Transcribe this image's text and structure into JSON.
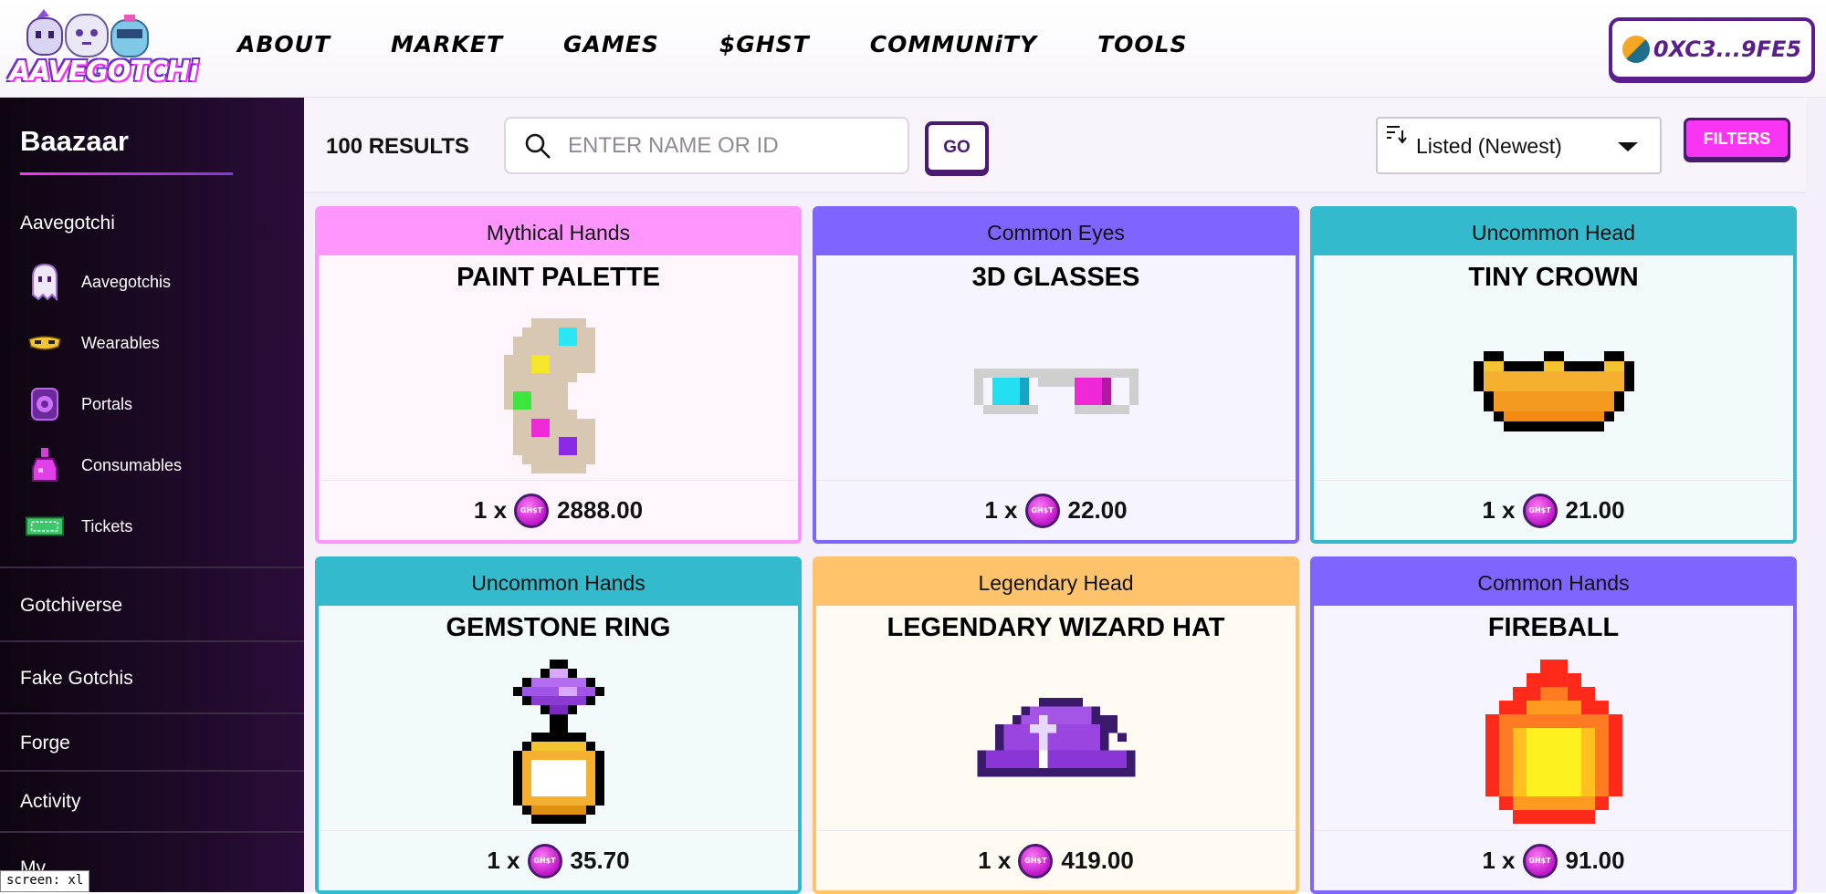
{
  "header": {
    "logo_text": "AAVEGOTCHi",
    "nav": [
      "ABOUT",
      "MARKET",
      "GAMES",
      "$GHST",
      "COMMUNiTY",
      "TOOLS"
    ],
    "wallet": "0XC3...9FE5"
  },
  "sidebar": {
    "title": "Baazaar",
    "section_aavegotchi": "Aavegotchi",
    "items": [
      {
        "label": "Aavegotchis",
        "icon": "ghost-icon"
      },
      {
        "label": "Wearables",
        "icon": "mask-icon"
      },
      {
        "label": "Portals",
        "icon": "portal-icon"
      },
      {
        "label": "Consumables",
        "icon": "potion-icon"
      },
      {
        "label": "Tickets",
        "icon": "ticket-icon"
      }
    ],
    "sections": [
      "Gotchiverse",
      "Fake Gotchis",
      "Forge",
      "Activity",
      "My"
    ],
    "screen_tag": "screen: xl"
  },
  "toolbar": {
    "results": "100 RESULTS",
    "search_placeholder": "ENTER NAME OR ID",
    "go_label": "GO",
    "sort_label": "Listed (Newest)",
    "filters_label": "FILTERS"
  },
  "colors": {
    "mythical": "#ff96ff",
    "common": "#8064ff",
    "uncommon": "#33bacc",
    "legendary": "#ffc36b",
    "accent": "#fa34f3",
    "brand_purple": "#4a1a73"
  },
  "cards": [
    {
      "rarity": "Mythical Hands",
      "name": "PAINT PALETTE",
      "qty": "1 x",
      "price": "2888.00",
      "tier": "mythical",
      "icon": "paint-palette-icon"
    },
    {
      "rarity": "Common Eyes",
      "name": "3D GLASSES",
      "qty": "1 x",
      "price": "22.00",
      "tier": "common",
      "icon": "3d-glasses-icon"
    },
    {
      "rarity": "Uncommon Head",
      "name": "TINY CROWN",
      "qty": "1 x",
      "price": "21.00",
      "tier": "uncommon",
      "icon": "crown-icon"
    },
    {
      "rarity": "Uncommon Hands",
      "name": "GEMSTONE RING",
      "qty": "1 x",
      "price": "35.70",
      "tier": "uncommon",
      "icon": "ring-icon"
    },
    {
      "rarity": "Legendary Head",
      "name": "LEGENDARY WIZARD HAT",
      "qty": "1 x",
      "price": "419.00",
      "tier": "legendary",
      "icon": "wizard-hat-icon"
    },
    {
      "rarity": "Common Hands",
      "name": "FIREBALL",
      "qty": "1 x",
      "price": "91.00",
      "tier": "common",
      "icon": "fireball-icon"
    }
  ],
  "ghst_coin_label": "GH$T"
}
